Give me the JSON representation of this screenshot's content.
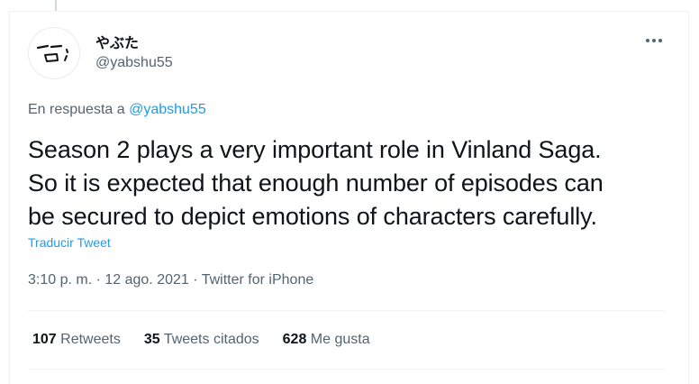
{
  "user": {
    "display_name": "やぶた",
    "handle": "@yabshu55"
  },
  "reply": {
    "prefix": "En respuesta a",
    "handle": "@yabshu55"
  },
  "tweet": {
    "lines": [
      "Season 2 plays a very important role in Vinland Saga.",
      "So it is expected that enough number of episodes can",
      "be secured to depict emotions of characters carefully."
    ],
    "translate_label": "Traducir Tweet",
    "timestamp": "3:10 p. m. · 12 ago. 2021",
    "separator": "·",
    "source": "Twitter for iPhone"
  },
  "stats": {
    "retweets": {
      "count": "107",
      "label": "Retweets"
    },
    "quotes": {
      "count": "35",
      "label": "Tweets citados"
    },
    "likes": {
      "count": "628",
      "label": "Me gusta"
    }
  },
  "icons": {
    "avatar": "face-drawing-avatar",
    "more": "more-options-icon"
  }
}
